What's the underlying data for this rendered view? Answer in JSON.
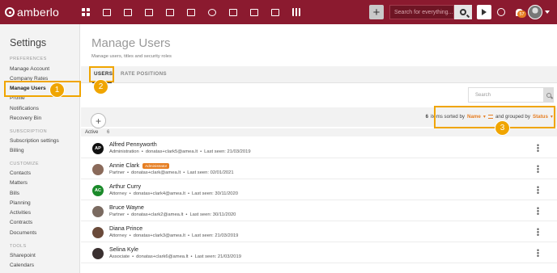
{
  "app": {
    "logo": "amberlo"
  },
  "topbar": {
    "nav_icons": [
      "grid-icon",
      "contact-card-icon",
      "briefcase-icon",
      "document-icon",
      "bank-icon",
      "calendar-icon",
      "history-icon",
      "folder-icon",
      "template-icon",
      "mail-icon",
      "chart-icon"
    ],
    "add_label": "+",
    "search_placeholder": "Search for everything...",
    "notification_count": "57"
  },
  "sidebar": {
    "title": "Settings",
    "sections": [
      {
        "label": "PREFERENCES",
        "items": [
          "Manage Account",
          "Company Rates",
          "Manage Users",
          "Profile",
          "Notifications",
          "Recovery Bin"
        ]
      },
      {
        "label": "SUBSCRIPTION",
        "items": [
          "Subscription settings",
          "Billing"
        ]
      },
      {
        "label": "CUSTOMIZE",
        "items": [
          "Contacts",
          "Matters",
          "Bills",
          "Planning",
          "Activities",
          "Contracts",
          "Documents"
        ]
      },
      {
        "label": "TOOLS",
        "items": [
          "Sharepoint",
          "Calendars"
        ]
      }
    ],
    "active_item": "Manage Users"
  },
  "main": {
    "title": "Manage Users",
    "subtitle": "Manage users, titles and security roles",
    "tabs": [
      {
        "label": "USERS"
      },
      {
        "label": "RATE POSITIONS"
      }
    ],
    "search_placeholder": "Search",
    "add_label": "+",
    "sort": {
      "count": "6",
      "items_sorted_by": "items sorted by",
      "sort_field": "Name",
      "grouped_by": "and grouped by",
      "group_field": "Status"
    },
    "group": {
      "label": "Active",
      "count": "6"
    },
    "users": [
      {
        "name": "Alfred Pennyworth",
        "initials": "AP",
        "avatar_color": "#111111",
        "badge": "",
        "role": "Administration",
        "email": "donatas+clark5@amea.lt",
        "last_seen": "Last seen: 21/03/2019"
      },
      {
        "name": "Annie Clark",
        "initials": "",
        "avatar_color": "#8a6a5a",
        "badge": "Administrator",
        "role": "Partner",
        "email": "donatas+clark@amea.lt",
        "last_seen": "Last seen: 02/01/2021"
      },
      {
        "name": "Arthur Curry",
        "initials": "AC",
        "avatar_color": "#1a8a2a",
        "badge": "",
        "role": "Attorney",
        "email": "donatas+clark4@amea.lt",
        "last_seen": "Last seen: 30/11/2020"
      },
      {
        "name": "Bruce Wayne",
        "initials": "",
        "avatar_color": "#7a6a60",
        "badge": "",
        "role": "Partner",
        "email": "donatas+clark2@amea.lt",
        "last_seen": "Last seen: 30/11/2020"
      },
      {
        "name": "Diana Prince",
        "initials": "",
        "avatar_color": "#6a4a3a",
        "badge": "",
        "role": "Attorney",
        "email": "donatas+clark3@amea.lt",
        "last_seen": "Last seen: 21/03/2019"
      },
      {
        "name": "Selina Kyle",
        "initials": "",
        "avatar_color": "#3a3030",
        "badge": "",
        "role": "Associate",
        "email": "donatas+clark6@amea.lt",
        "last_seen": "Last seen: 21/03/2019"
      }
    ],
    "meta_separator": "•"
  },
  "callouts": [
    "1",
    "2",
    "3"
  ],
  "colors": {
    "brand": "#8b1a2f",
    "accent": "#e67e22",
    "callout": "#f0a500"
  }
}
